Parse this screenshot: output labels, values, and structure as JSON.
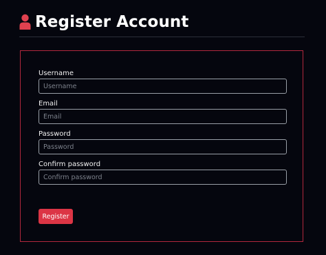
{
  "header": {
    "icon": "user-icon",
    "title": "Register Account"
  },
  "colors": {
    "accent": "#dc3545",
    "icon": "#e0414f",
    "background": "#05060e",
    "panel_border": "#b3283d"
  },
  "form": {
    "fields": [
      {
        "label": "Username",
        "placeholder": "Username",
        "value": ""
      },
      {
        "label": "Email",
        "placeholder": "Email",
        "value": ""
      },
      {
        "label": "Password",
        "placeholder": "Password",
        "value": ""
      },
      {
        "label": "Confirm password",
        "placeholder": "Confirm password",
        "value": ""
      }
    ],
    "submit_label": "Register"
  }
}
